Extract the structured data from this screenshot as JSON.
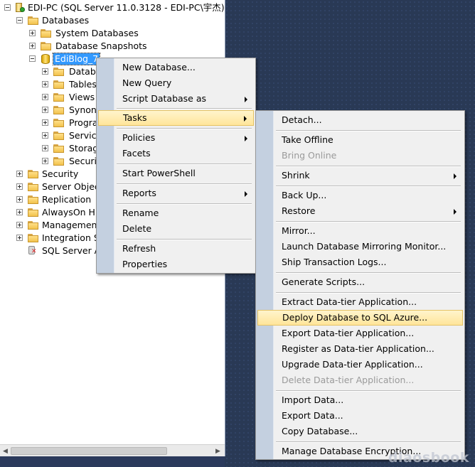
{
  "tree": {
    "server": "EDI-PC (SQL Server 11.0.3128 - EDI-PC\\宇杰)",
    "databases": "Databases",
    "system_databases": "System Databases",
    "database_snapshots": "Database Snapshots",
    "selected_db": "EdiBlog_7",
    "db_children": [
      "Datab",
      "Tables",
      "Views",
      "Synony",
      "Progra",
      "Service",
      "Storag",
      "Securit"
    ],
    "security": "Security",
    "server_objects": "Server Objec",
    "replication": "Replication",
    "alwayson": "AlwaysOn Hig",
    "management": "Management",
    "integration": "Integration S",
    "agent": "SQL Server A"
  },
  "context_menu": {
    "new_database": "New Database...",
    "new_query": "New Query",
    "script_database_as": "Script Database as",
    "tasks": "Tasks",
    "policies": "Policies",
    "facets": "Facets",
    "start_powershell": "Start PowerShell",
    "reports": "Reports",
    "rename": "Rename",
    "delete": "Delete",
    "refresh": "Refresh",
    "properties": "Properties"
  },
  "tasks_menu": {
    "detach": "Detach...",
    "take_offline": "Take Offline",
    "bring_online": "Bring Online",
    "shrink": "Shrink",
    "back_up": "Back Up...",
    "restore": "Restore",
    "mirror": "Mirror...",
    "launch_mirroring_monitor": "Launch Database Mirroring Monitor...",
    "ship_transaction_logs": "Ship Transaction Logs...",
    "generate_scripts": "Generate Scripts...",
    "extract_data_tier": "Extract Data-tier Application...",
    "deploy_sql_azure": "Deploy Database to SQL Azure...",
    "export_data_tier": "Export Data-tier Application...",
    "register_data_tier": "Register as Data-tier Application...",
    "upgrade_data_tier": "Upgrade Data-tier Application...",
    "delete_data_tier": "Delete Data-tier Application...",
    "import_data": "Import Data...",
    "export_data": "Export Data...",
    "copy_database": "Copy Database...",
    "manage_encryption": "Manage Database Encryption..."
  },
  "watermark": "diaosbook"
}
